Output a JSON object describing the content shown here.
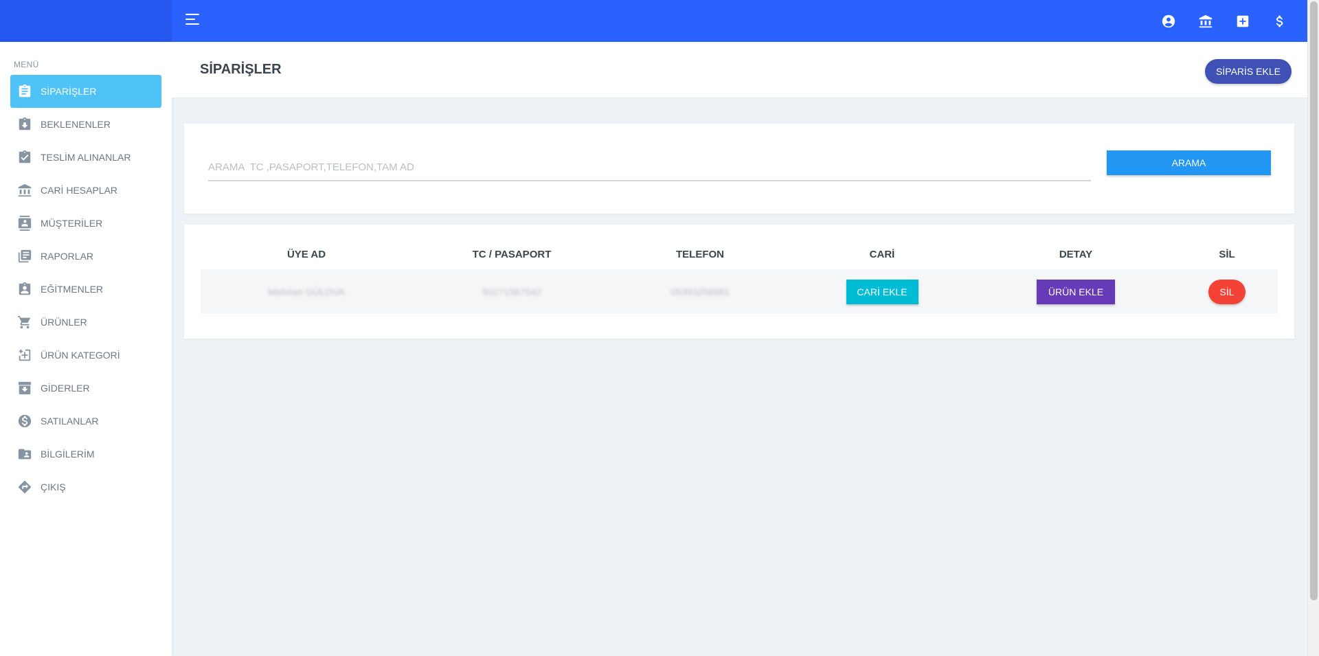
{
  "colors": {
    "topbar": "#2962ff",
    "active_menu": "#4fc3f7",
    "primary_button": "#3f51b5",
    "search_button": "#2196f3",
    "cari_button": "#00bcd4",
    "urun_button": "#673ab7",
    "sil_button": "#f44336"
  },
  "topbar": {
    "icons": [
      "account-circle-icon",
      "bank-icon",
      "plus-square-icon",
      "dollar-icon"
    ]
  },
  "sidebar": {
    "caption": "MENÜ",
    "items": [
      {
        "label": "SİPARİŞLER",
        "icon": "clipboard-text-icon",
        "active": true
      },
      {
        "label": "BEKLENENLER",
        "icon": "clipboard-arrow-down-icon",
        "active": false
      },
      {
        "label": "TESLİM ALINANLAR",
        "icon": "clipboard-check-icon",
        "active": false
      },
      {
        "label": "CARİ HESAPLAR",
        "icon": "bank-icon",
        "active": false
      },
      {
        "label": "MÜŞTERİLER",
        "icon": "contact-card-icon",
        "active": false
      },
      {
        "label": "RAPORLAR",
        "icon": "library-books-icon",
        "active": false
      },
      {
        "label": "EĞİTMENLER",
        "icon": "clipboard-account-icon",
        "active": false
      },
      {
        "label": "ÜRÜNLER",
        "icon": "cart-icon",
        "active": false
      },
      {
        "label": "ÜRÜN KATEGORİ",
        "icon": "category-plus-icon",
        "active": false
      },
      {
        "label": "GİDERLER",
        "icon": "archive-arrow-icon",
        "active": false
      },
      {
        "label": "SATILANLAR",
        "icon": "dollar-circle-icon",
        "active": false
      },
      {
        "label": "BİLGİLERİM",
        "icon": "folder-account-icon",
        "active": false
      },
      {
        "label": "ÇIKIŞ",
        "icon": "directions-icon",
        "active": false
      }
    ]
  },
  "header": {
    "title": "SİPARİŞLER",
    "add_button": "SİPARİS EKLE"
  },
  "search": {
    "placeholder": "ARAMA  TC ,PASAPORT,TELEFON,TAM AD",
    "value": "",
    "button": "ARAMA"
  },
  "table": {
    "columns": [
      "ÜYE AD",
      "TC / PASAPORT",
      "TELEFON",
      "CARİ",
      "DETAY",
      "SİL"
    ],
    "rows": [
      {
        "name": "Mehmet GÜLOVA",
        "id_number": "50271567542",
        "phone": "05393258981",
        "cari_button": "CARİ EKLE",
        "detail_button": "ÜRÜN EKLE",
        "delete_button": "SİL"
      }
    ]
  }
}
